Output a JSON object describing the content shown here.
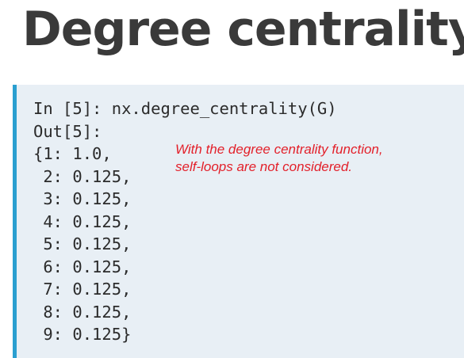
{
  "title": "Degree centrality",
  "code": {
    "lines": [
      "In [5]: nx.degree_centrality(G)",
      "Out[5]:",
      "{1: 1.0,",
      " 2: 0.125,",
      " 3: 0.125,",
      " 4: 0.125,",
      " 5: 0.125,",
      " 6: 0.125,",
      " 7: 0.125,",
      " 8: 0.125,",
      " 9: 0.125}"
    ]
  },
  "note": {
    "lines": [
      "With the degree centrality function,",
      "self-loops are not considered."
    ]
  },
  "colors": {
    "title": "#3a3a3a",
    "code_background": "#e8eff5",
    "accent_bar": "#2a9fd0",
    "note": "#e3202a"
  }
}
